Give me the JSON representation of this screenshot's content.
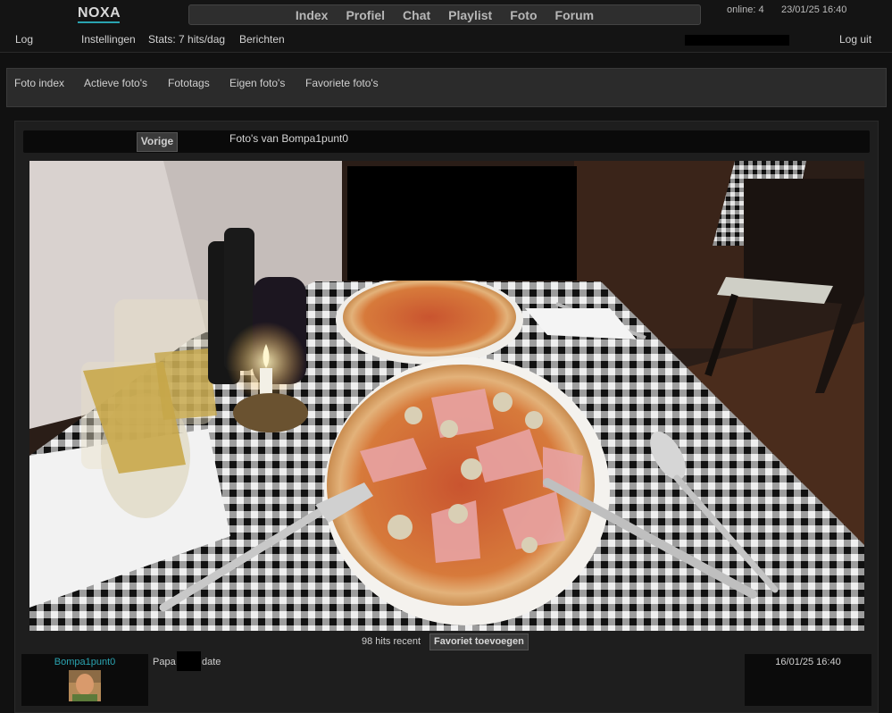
{
  "header": {
    "logo": "NOXA",
    "nav": [
      "Index",
      "Profiel",
      "Chat",
      "Playlist",
      "Foto",
      "Forum"
    ],
    "online": "online: 4",
    "datetime": "23/01/25 16:40",
    "sub": {
      "log": "Log",
      "settings": "Instellingen",
      "stats": "Stats: 7 hits/dag",
      "messages": "Berichten",
      "logout": "Log uit"
    }
  },
  "foto_nav": [
    "Foto index",
    "Actieve foto's",
    "Fototags",
    "Eigen foto's",
    "Favoriete foto's"
  ],
  "photo": {
    "prev_label": "Vorige",
    "title": "Foto's van Bompa1punt0",
    "hits": "98 hits recent",
    "fav_label": "Favoriet toevoegen"
  },
  "comment": {
    "author": "Bompa1punt0",
    "text_before": "Papa",
    "text_after": "date",
    "date": "16/01/25 16:40"
  },
  "colors": {
    "accent": "#2aa3b0",
    "background": "#111111"
  }
}
